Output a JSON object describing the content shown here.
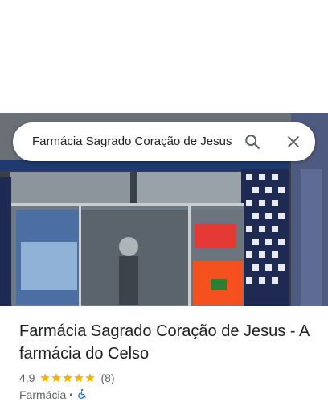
{
  "search": {
    "query": "Farmácia Sagrado Coração de Jesus"
  },
  "icons": {
    "search": "search-icon",
    "close": "close-icon",
    "accessibility": "wheelchair-icon"
  },
  "place": {
    "title": "Farmácia Sagrado Coração de Jesus - A farmácia do Celso",
    "rating": "4,9",
    "rating_value": 4.9,
    "stars": 5,
    "reviews": "(8)",
    "category": "Farmácia",
    "separator": "•"
  },
  "colors": {
    "star": "#f4b400",
    "accent": "#1a73e8",
    "text": "#202124",
    "secondary": "#5f6368"
  }
}
